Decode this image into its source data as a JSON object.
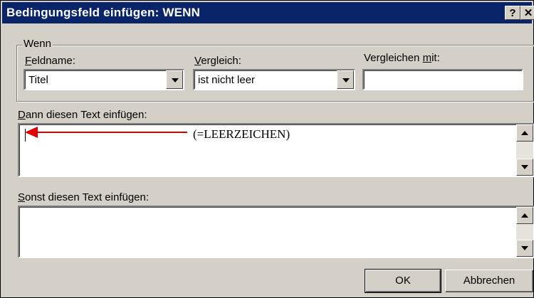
{
  "window": {
    "title": "Bedingungsfeld einfügen: WENN",
    "help_button": "?",
    "close_button": "✕"
  },
  "group": {
    "legend": "Wenn"
  },
  "fieldname": {
    "label_accel": "F",
    "label_rest": "eldname:",
    "value": "Titel"
  },
  "comparison": {
    "label_accel": "V",
    "label_rest": "ergleich:",
    "value": "ist nicht leer"
  },
  "compare_with": {
    "label_pre": "Vergleichen ",
    "label_accel": "m",
    "label_rest": "it:",
    "value": ""
  },
  "then_text": {
    "label_accel": "D",
    "label_rest": "ann diesen Text einfügen:",
    "value": ""
  },
  "else_text": {
    "label_accel": "S",
    "label_rest": "onst diesen Text einfügen:",
    "value": ""
  },
  "annotation": {
    "text": "(=LEERZEICHEN)",
    "arrow_color": "#e00000"
  },
  "buttons": {
    "ok": "OK",
    "cancel": "Abbrechen"
  },
  "colors": {
    "titlebar": "#0a246a",
    "dialog_bg": "#d4d0c8"
  }
}
